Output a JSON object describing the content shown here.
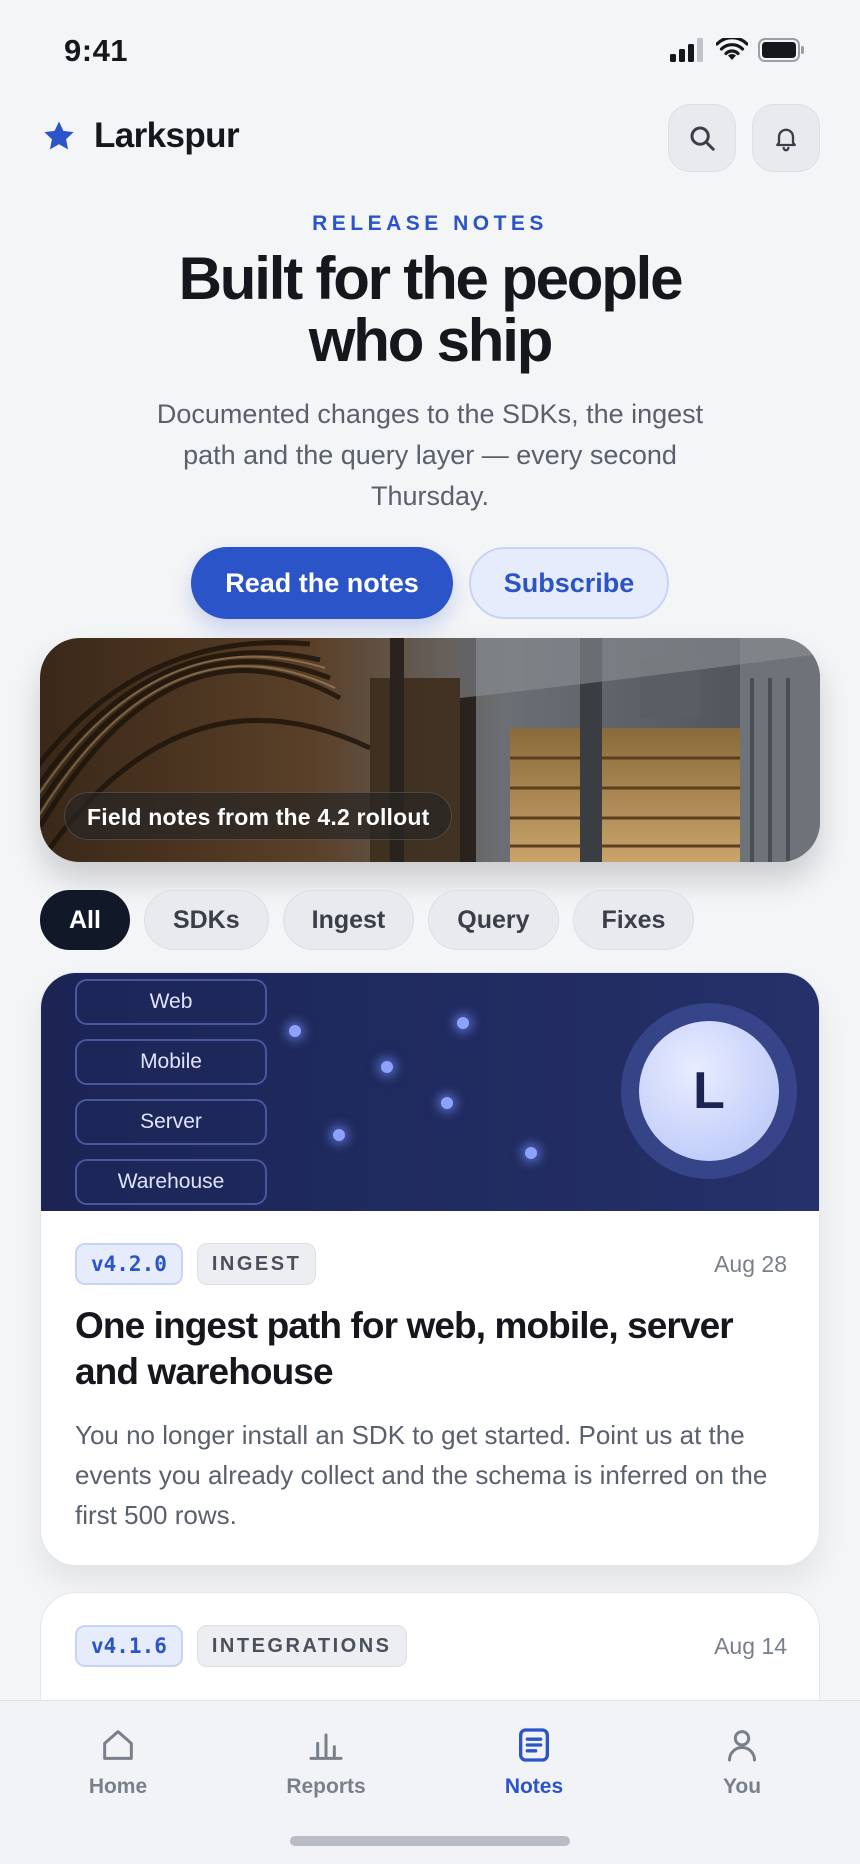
{
  "status_bar": {
    "time": "9:41"
  },
  "header": {
    "brand": "Larkspur"
  },
  "hero": {
    "eyebrow": "RELEASE NOTES",
    "title": "Built for the people who ship",
    "subtitle": "Documented changes to the SDKs, the ingest path and the query layer — every second Thursday.",
    "primary_cta": "Read the notes",
    "secondary_cta": "Subscribe"
  },
  "banner": {
    "caption": "Field notes from the 4.2 rollout"
  },
  "filters": [
    {
      "label": "All",
      "active": true
    },
    {
      "label": "SDKs",
      "active": false
    },
    {
      "label": "Ingest",
      "active": false
    },
    {
      "label": "Query",
      "active": false
    },
    {
      "label": "Fixes",
      "active": false
    }
  ],
  "posts": [
    {
      "sources": [
        "Web",
        "Mobile",
        "Server",
        "Warehouse"
      ],
      "orb_letter": "L",
      "version": "v4.2.0",
      "tag": "INGEST",
      "date": "Aug 28",
      "title": "One ingest path for web, mobile, server and warehouse",
      "body": "You no longer install an SDK to get started. Point us at the events you already collect and the schema is inferred on the first 500 rows."
    },
    {
      "version": "v4.1.6",
      "tag": "INTEGRATIONS",
      "date": "Aug 14"
    }
  ],
  "bottom_nav": [
    {
      "label": "Home",
      "icon": "home-icon"
    },
    {
      "label": "Reports",
      "icon": "bar-chart-icon"
    },
    {
      "label": "Notes",
      "icon": "notes-icon",
      "active": true
    },
    {
      "label": "You",
      "icon": "person-icon"
    }
  ],
  "colors": {
    "accent": "#2a54c7",
    "ink": "#15171c",
    "muted": "#5a606c",
    "card_hero": "#1f2a5e"
  }
}
